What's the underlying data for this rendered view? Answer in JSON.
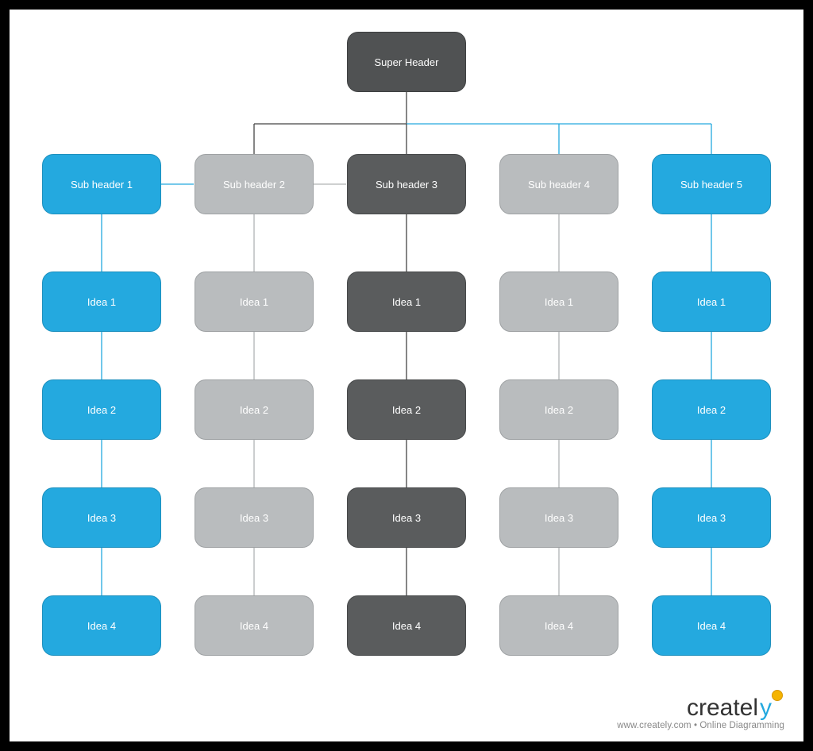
{
  "super_header": "Super Header",
  "columns": [
    {
      "style": "blue",
      "header": "Sub header 1",
      "ideas": [
        "Idea 1",
        "Idea 2",
        "Idea 3",
        "Idea 4"
      ]
    },
    {
      "style": "grey",
      "header": "Sub header 2",
      "ideas": [
        "Idea 1",
        "Idea 2",
        "Idea 3",
        "Idea 4"
      ]
    },
    {
      "style": "mid",
      "header": "Sub header 3",
      "ideas": [
        "Idea 1",
        "Idea 2",
        "Idea 3",
        "Idea 4"
      ]
    },
    {
      "style": "grey",
      "header": "Sub header 4",
      "ideas": [
        "Idea 1",
        "Idea 2",
        "Idea 3",
        "Idea 4"
      ]
    },
    {
      "style": "blue",
      "header": "Sub header 5",
      "ideas": [
        "Idea 1",
        "Idea 2",
        "Idea 3",
        "Idea 4"
      ]
    }
  ],
  "branding": {
    "name": "creately",
    "tagline": "www.creately.com • Online Diagramming"
  },
  "colors": {
    "blue": "#24a9df",
    "grey": "#b9bcbe",
    "dark": "#505253",
    "mid": "#5a5c5d",
    "accent_yellow": "#f5b400"
  }
}
